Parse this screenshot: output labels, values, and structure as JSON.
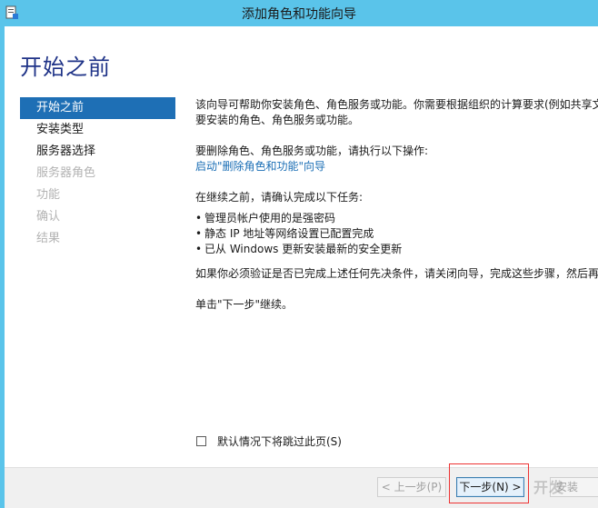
{
  "window": {
    "title": "添加角色和功能向导"
  },
  "page": {
    "heading": "开始之前"
  },
  "nav": {
    "items": [
      {
        "label": "开始之前",
        "state": "active"
      },
      {
        "label": "安装类型",
        "state": "normal"
      },
      {
        "label": "服务器选择",
        "state": "normal"
      },
      {
        "label": "服务器角色",
        "state": "disabled"
      },
      {
        "label": "功能",
        "state": "disabled"
      },
      {
        "label": "确认",
        "state": "disabled"
      },
      {
        "label": "结果",
        "state": "disabled"
      }
    ]
  },
  "content": {
    "intro_line1": "该向导可帮助你安装角色、角色服务或功能。你需要根据组织的计算要求(例如共享文",
    "intro_line2": "要安装的角色、角色服务或功能。",
    "remove_text": "要删除角色、角色服务或功能，请执行以下操作:",
    "remove_link": "启动\"删除角色和功能\"向导",
    "before_text": "在继续之前，请确认完成以下任务:",
    "tasks": [
      "管理员帐户使用的是强密码",
      "静态 IP 地址等网络设置已配置完成",
      "已从 Windows 更新安装最新的安全更新"
    ],
    "verify_text": "如果你必须验证是否已完成上述任何先决条件，请关闭向导，完成这些步骤，然后再",
    "next_hint": "单击\"下一步\"继续。"
  },
  "skip_checkbox": {
    "label": "默认情况下将跳过此页(S)",
    "checked": false
  },
  "buttons": {
    "prev": "< 上一步(P)",
    "next": "下一步(N) >",
    "install": "安装"
  },
  "watermark": "开发"
}
